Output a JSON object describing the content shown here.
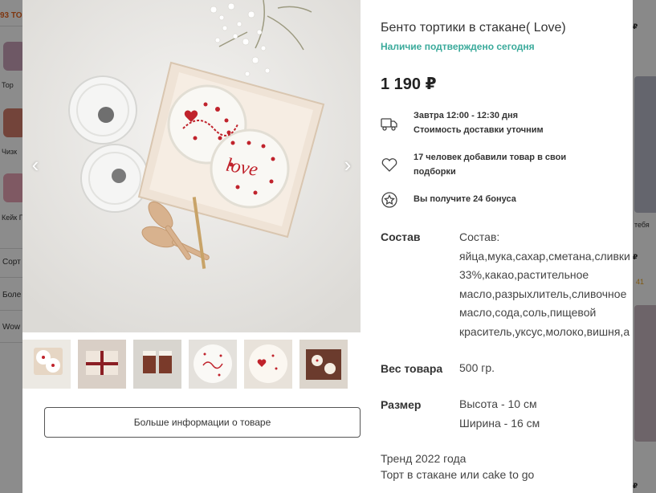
{
  "background": {
    "count_label": "93 ТО",
    "categories": [
      "Тор",
      "Чизк",
      "Кейк П"
    ],
    "rows": [
      "Сорт",
      "Боле",
      "Wow"
    ],
    "right_snippets": [
      "₽",
      "тебя",
      "₽",
      "41",
      "₽"
    ]
  },
  "gallery": {
    "prev_icon": "chevron-left-icon",
    "next_icon": "chevron-right-icon",
    "thumb_count": 6,
    "main_image_text": "love"
  },
  "more_button_label": "Больше информации о товаре",
  "product": {
    "title": "Бенто тортики в стакане( Love)",
    "availability": "Наличие подтверждено сегодня",
    "price": "1 190 ₽",
    "features": [
      {
        "icon": "delivery-truck-icon",
        "lines": [
          "Завтра 12:00 - 12:30 дня",
          "Стоимость доставки уточним"
        ]
      },
      {
        "icon": "heart-icon",
        "lines": [
          "17 человек добавили товар в свои",
          "подборки"
        ]
      },
      {
        "icon": "star-badge-icon",
        "lines": [
          "Вы получите 24 бонуса"
        ]
      }
    ],
    "specs": [
      {
        "label": "Состав",
        "lines": [
          "Состав:",
          "яйца,мука,сахар,сметана,сливки",
          "33%,какао,растительное",
          "масло,разрыхлитель,сливочное",
          "масло,сода,соль,пищевой",
          "краситель,уксус,молоко,вишня,а"
        ]
      },
      {
        "label": "Вес товара",
        "lines": [
          "500 гр."
        ]
      },
      {
        "label": "Размер",
        "lines": [
          "Высота - 10 см",
          "Ширина - 16 см"
        ]
      }
    ],
    "trend_lines": [
      "Тренд 2022 года",
      "Торт в стакане или cake to go"
    ]
  },
  "colors": {
    "accent_teal": "#3aaa9b",
    "accent_orange": "#e8641e",
    "cake_red": "#c0232c"
  }
}
